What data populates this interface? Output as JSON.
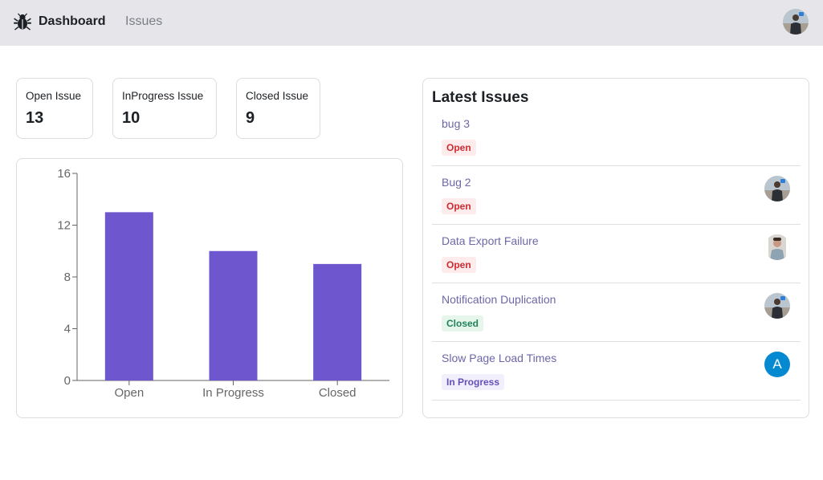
{
  "nav": {
    "brand_label": "Dashboard",
    "issues_label": "Issues",
    "logo_icon": "bug-icon"
  },
  "stats": [
    {
      "label": "Open Issue",
      "value": "13"
    },
    {
      "label": "InProgress Issue",
      "value": "10"
    },
    {
      "label": "Closed Issue",
      "value": "9"
    }
  ],
  "chart_data": {
    "type": "bar",
    "categories": [
      "Open",
      "In Progress",
      "Closed"
    ],
    "values": [
      13,
      10,
      9
    ],
    "ylim": [
      0,
      16
    ],
    "yticks": [
      0,
      4,
      8,
      12,
      16
    ],
    "bar_color": "#6e56cf",
    "grid": false,
    "legend": "none"
  },
  "latest": {
    "title": "Latest Issues",
    "issues": [
      {
        "title": "bug 3",
        "status": "Open",
        "assignee": null
      },
      {
        "title": "Bug 2",
        "status": "Open",
        "assignee": "photo-avatar-1"
      },
      {
        "title": "Data Export Failure",
        "status": "Open",
        "assignee": "photo-avatar-2"
      },
      {
        "title": "Notification Duplication",
        "status": "Closed",
        "assignee": "photo-avatar-1"
      },
      {
        "title": "Slow Page Load Times",
        "status": "In Progress",
        "assignee": "A"
      }
    ]
  },
  "colors": {
    "nav_bg": "#e6e6ea",
    "accent": "#6e56cf",
    "open": "#ce2c31",
    "closed": "#218358",
    "in_progress": "#6550b9",
    "letter_avatar_bg": "#0589d0"
  }
}
